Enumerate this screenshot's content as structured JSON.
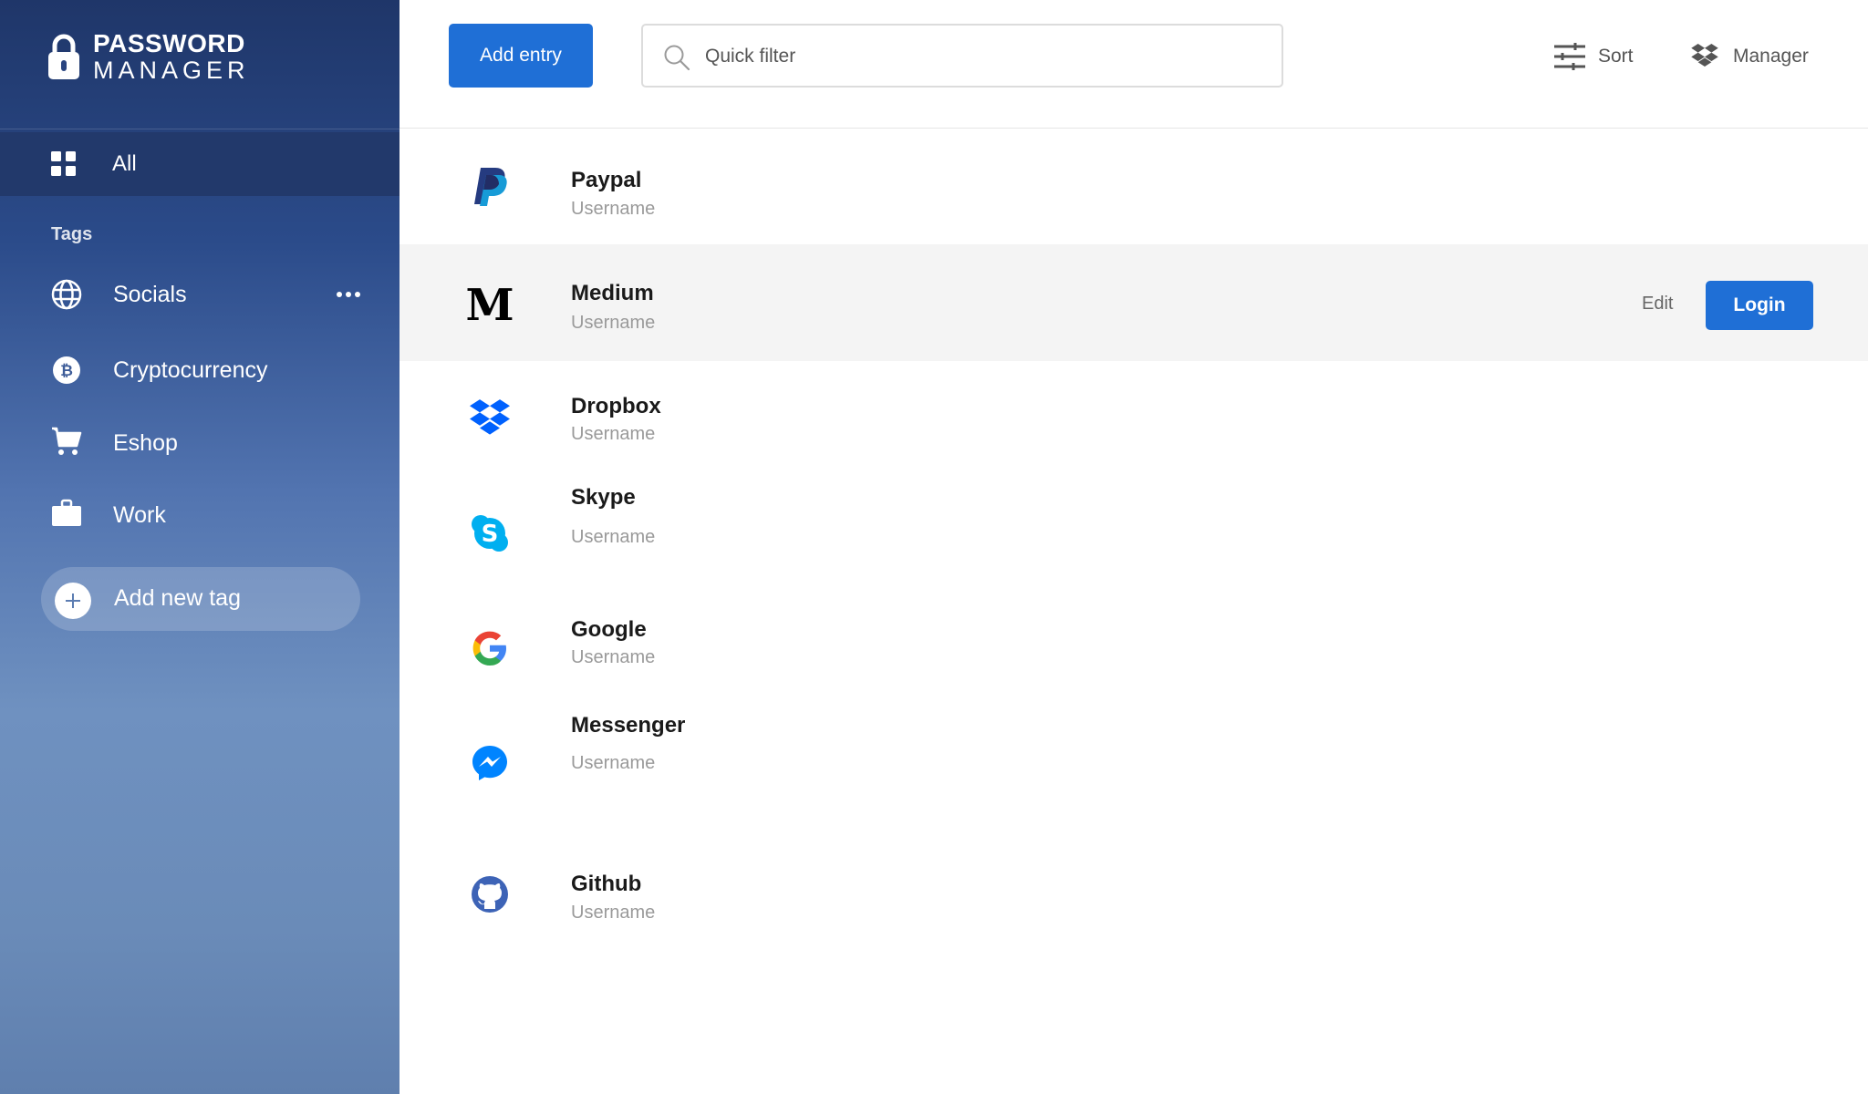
{
  "brand": {
    "line1": "PASSWORD",
    "line2": "MANAGER",
    "icon": "lock-icon"
  },
  "sidebar": {
    "all": {
      "label": "All",
      "icon": "grid-icon"
    },
    "tags_heading": "Tags",
    "tags": [
      {
        "label": "Socials",
        "icon": "globe-icon"
      },
      {
        "label": "Cryptocurrency",
        "icon": "bitcoin-icon"
      },
      {
        "label": "Eshop",
        "icon": "cart-icon"
      },
      {
        "label": "Work",
        "icon": "briefcase-icon"
      }
    ],
    "add_tag_label": "Add new tag"
  },
  "toolbar": {
    "add_entry_label": "Add entry",
    "search_placeholder": "Quick filter",
    "sort_label": "Sort",
    "manager_label": "Manager"
  },
  "entries": [
    {
      "name": "Paypal",
      "username": "Username",
      "icon": "paypal-logo"
    },
    {
      "name": "Medium",
      "username": "Username",
      "icon": "medium-logo",
      "edit_label": "Edit",
      "login_label": "Login"
    },
    {
      "name": "Dropbox",
      "username": "Username",
      "icon": "dropbox-logo"
    },
    {
      "name": "Skype",
      "username": "Username",
      "icon": "skype-logo"
    },
    {
      "name": "Google",
      "username": "Username",
      "icon": "google-logo"
    },
    {
      "name": "Messenger",
      "username": "Username",
      "icon": "messenger-logo"
    },
    {
      "name": "Github",
      "username": "Username",
      "icon": "github-logo"
    }
  ],
  "colors": {
    "accent": "#1f6fd6",
    "sidebar_top": "#1f3669",
    "sidebar_bottom": "#5f7fae",
    "active_nav": "#22396b",
    "highlight_row": "#f4f4f4"
  }
}
